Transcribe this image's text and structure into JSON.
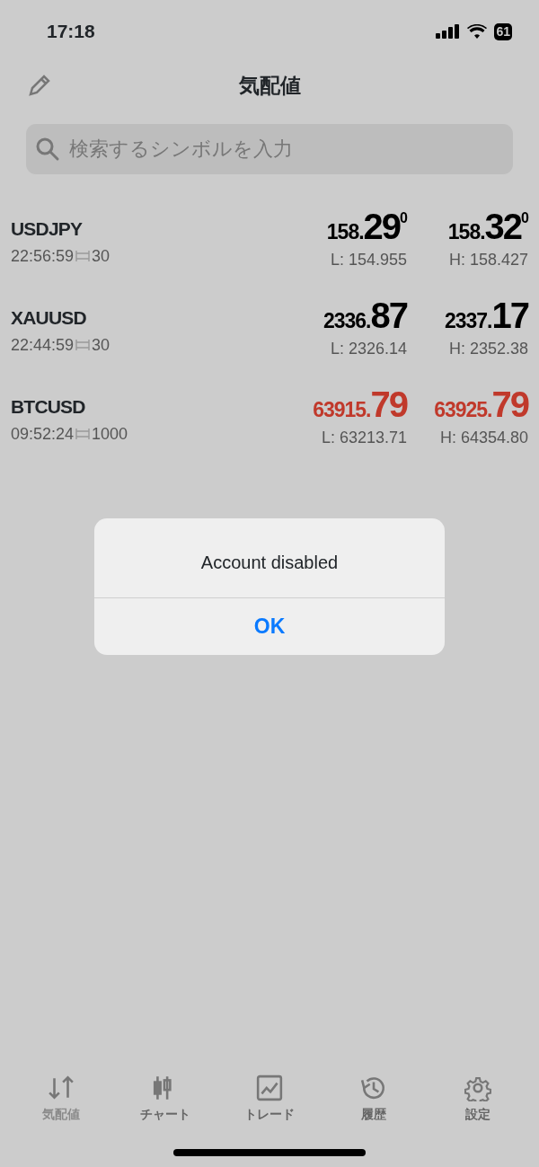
{
  "status_bar": {
    "time": "17:18",
    "battery": "61"
  },
  "header": {
    "title": "気配値"
  },
  "search": {
    "placeholder": "検索するシンボルを入力"
  },
  "quotes": [
    {
      "symbol": "USDJPY",
      "time": "22:56:59",
      "spread": "30",
      "bid": {
        "head": "158.",
        "big": "29",
        "sup": "0",
        "color": "#000000"
      },
      "ask": {
        "head": "158.",
        "big": "32",
        "sup": "0",
        "color": "#000000"
      },
      "low": "L: 154.955",
      "high": "H: 158.427"
    },
    {
      "symbol": "XAUUSD",
      "time": "22:44:59",
      "spread": "30",
      "bid": {
        "head": "2336.",
        "big": "87",
        "color": "#000000"
      },
      "ask": {
        "head": "2337.",
        "big": "17",
        "color": "#000000"
      },
      "low": "L: 2326.14",
      "high": "H: 2352.38"
    },
    {
      "symbol": "BTCUSD",
      "time": "09:52:24",
      "spread": "1000",
      "bid": {
        "head": "63915.",
        "big": "79",
        "color": "#c0392b"
      },
      "ask": {
        "head": "63925.",
        "big": "79",
        "color": "#c0392b"
      },
      "low": "L: 63213.71",
      "high": "H: 64354.80"
    }
  ],
  "alert": {
    "message": "Account disabled",
    "button": "OK"
  },
  "tabs": [
    {
      "label": "気配値",
      "kind": "quotes",
      "selected": true
    },
    {
      "label": "チャート",
      "kind": "chart",
      "selected": false
    },
    {
      "label": "トレード",
      "kind": "trade",
      "selected": false
    },
    {
      "label": "履歴",
      "kind": "history",
      "selected": false
    },
    {
      "label": "設定",
      "kind": "settings",
      "selected": false
    }
  ]
}
